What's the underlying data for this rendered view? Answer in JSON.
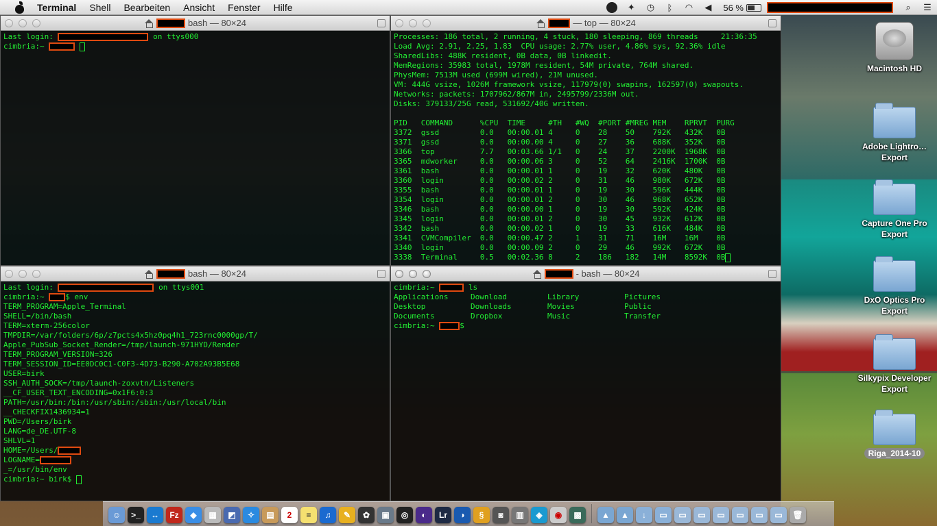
{
  "menubar": {
    "app_name": "Terminal",
    "items": [
      "Shell",
      "Bearbeiten",
      "Ansicht",
      "Fenster",
      "Hilfe"
    ],
    "battery_percent": "56 %"
  },
  "windows": {
    "top_left": {
      "title": "bash — 80×24",
      "lines": {
        "login_prefix": "Last login: ",
        "login_suffix": " on ttys000",
        "prompt": "cimbria:~ "
      }
    },
    "top_right": {
      "title": "— top — 80×24",
      "summary": [
        "Processes: 186 total, 2 running, 4 stuck, 180 sleeping, 869 threads     21:36:35",
        "Load Avg: 2.91, 2.25, 1.83  CPU usage: 2.77% user, 4.86% sys, 92.36% idle",
        "SharedLibs: 488K resident, 0B data, 0B linkedit.",
        "MemRegions: 35983 total, 1978M resident, 54M private, 764M shared.",
        "PhysMem: 7513M used (699M wired), 21M unused.",
        "VM: 444G vsize, 1026M framework vsize, 117979(0) swapins, 162597(0) swapouts.",
        "Networks: packets: 1707962/867M in, 2495799/2336M out.",
        "Disks: 379133/25G read, 531692/40G written."
      ],
      "table_header": "PID   COMMAND      %CPU  TIME     #TH   #WQ  #PORT #MREG MEM    RPRVT  PURG",
      "rows": [
        "3372  gssd         0.0   00:00.01 4     0    28    50    792K   432K   0B",
        "3371  gssd         0.0   00:00.00 4     0    27    36    688K   352K   0B",
        "3366  top          7.7   00:03.66 1/1   0    24    37    2200K  1968K  0B",
        "3365  mdworker     0.0   00:00.06 3     0    52    64    2416K  1700K  0B",
        "3361  bash         0.0   00:00.01 1     0    19    32    620K   480K   0B",
        "3360  login        0.0   00:00.02 2     0    31    46    980K   672K   0B",
        "3355  bash         0.0   00:00.01 1     0    19    30    596K   444K   0B",
        "3354  login        0.0   00:00.01 2     0    30    46    968K   652K   0B",
        "3346  bash         0.0   00:00.00 1     0    19    30    592K   424K   0B",
        "3345  login        0.0   00:00.01 2     0    30    45    932K   612K   0B",
        "3342  bash         0.0   00:00.02 1     0    19    33    616K   484K   0B",
        "3341  CVMCompiler  0.0   00:00.47 2     1    31    71    16M    16M    0B",
        "3340  login        0.0   00:00.09 2     0    29    46    992K   672K   0B",
        "3338  Terminal     0.5   00:02.36 8     2    186   182   14M    8592K  0B"
      ]
    },
    "bottom_left": {
      "title": "bash — 80×24",
      "login_prefix": "Last login: ",
      "login_suffix": " on ttys001",
      "prompt": "cimbria:~ ",
      "command": "$ env",
      "env_lines": [
        "TERM_PROGRAM=Apple_Terminal",
        "SHELL=/bin/bash",
        "TERM=xterm-256color",
        "TMPDIR=/var/folders/6p/z7pcts4x5hz0pq4h1_723rnc0000gp/T/",
        "Apple_PubSub_Socket_Render=/tmp/launch-971HYD/Render",
        "TERM_PROGRAM_VERSION=326",
        "TERM_SESSION_ID=EE0DC0C1-C0F3-4D73-B290-A702A93B5E68",
        "USER=birk",
        "SSH_AUTH_SOCK=/tmp/launch-zoxvtn/Listeners",
        "__CF_USER_TEXT_ENCODING=0x1F6:0:3",
        "PATH=/usr/bin:/bin:/usr/sbin:/sbin:/usr/local/bin",
        "__CHECKFIX1436934=1",
        "PWD=/Users/birk",
        "LANG=de_DE.UTF-8",
        "SHLVL=1"
      ],
      "home_prefix": "HOME=/Users/",
      "logname_prefix": "LOGNAME=",
      "last_env": "_=/usr/bin/env",
      "final_prompt": "cimbria:~ birk$ "
    },
    "bottom_right": {
      "title": "- bash — 80×24",
      "prompt": "cimbria:~ ",
      "command": " ls",
      "ls_items": [
        "Applications",
        "Download",
        "Library",
        "Pictures",
        "Desktop",
        "Downloads",
        "Movies",
        "Public",
        "Documents",
        "Dropbox",
        "Music",
        "Transfer"
      ],
      "prompt_suffix": "$"
    }
  },
  "desktop": {
    "icons": [
      "Macintosh HD",
      "Adobe Lightro…Export",
      "Capture One Pro Export",
      "DxO Optics Pro Export",
      "Silkypix Developer Export",
      "Riga_2014-10"
    ]
  },
  "dock": {
    "lightroom_label": "Lr",
    "filezilla_label": "Fz",
    "calendar_day": "2"
  }
}
